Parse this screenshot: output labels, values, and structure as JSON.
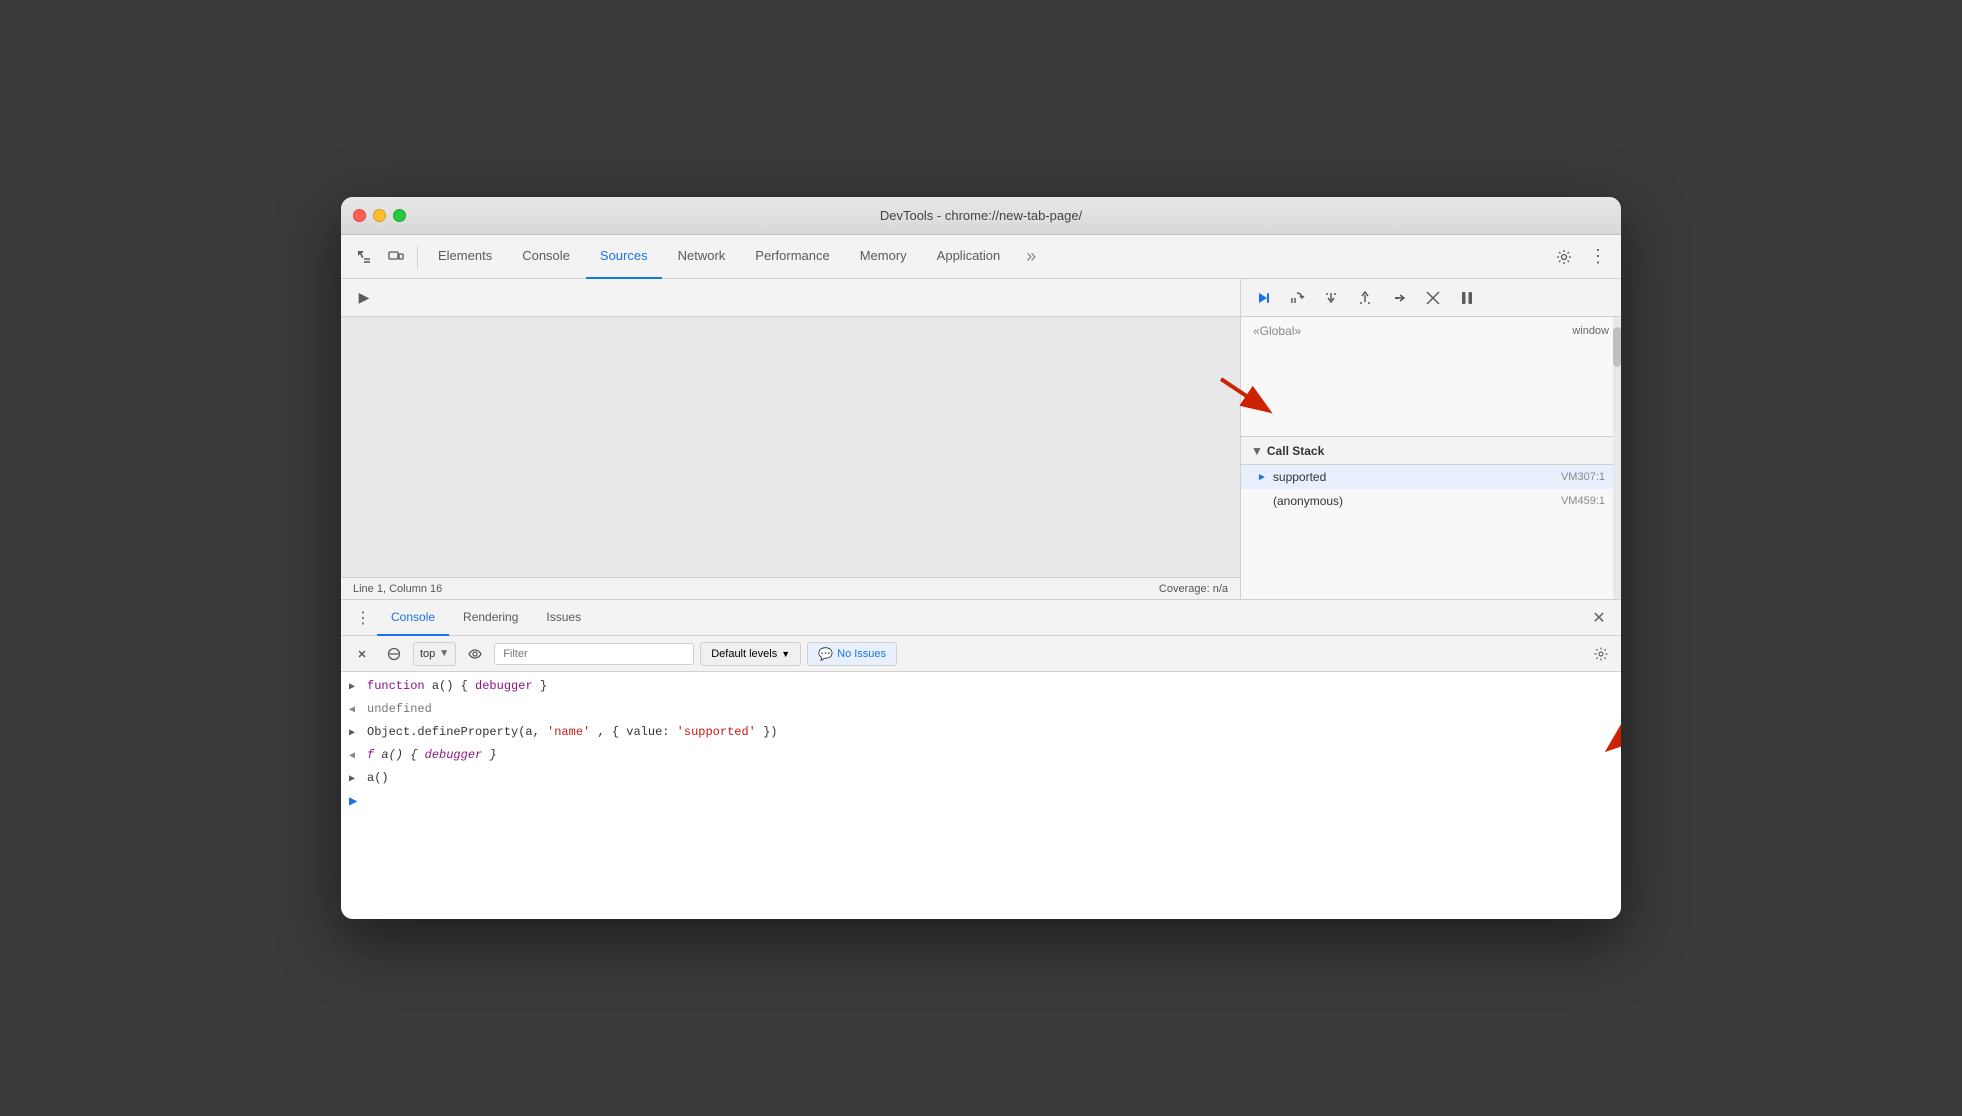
{
  "window": {
    "title": "DevTools - chrome://new-tab-page/"
  },
  "toolbar": {
    "tabs": [
      {
        "id": "elements",
        "label": "Elements",
        "active": false
      },
      {
        "id": "console",
        "label": "Console",
        "active": false
      },
      {
        "id": "sources",
        "label": "Sources",
        "active": true
      },
      {
        "id": "network",
        "label": "Network",
        "active": false
      },
      {
        "id": "performance",
        "label": "Performance",
        "active": false
      },
      {
        "id": "memory",
        "label": "Memory",
        "active": false
      },
      {
        "id": "application",
        "label": "Application",
        "active": false
      }
    ]
  },
  "status_bar": {
    "position": "Line 1, Column 16",
    "coverage": "Coverage: n/a"
  },
  "call_stack": {
    "header": "Call Stack",
    "items": [
      {
        "name": "supported",
        "location": "VM307:1",
        "active": true
      },
      {
        "name": "(anonymous)",
        "location": "VM459:1",
        "active": false
      }
    ],
    "scope_items": [
      {
        "name": "«Global»",
        "val": "window"
      }
    ]
  },
  "console_panel": {
    "tabs": [
      {
        "id": "console",
        "label": "Console",
        "active": true
      },
      {
        "id": "rendering",
        "label": "Rendering",
        "active": false
      },
      {
        "id": "issues",
        "label": "Issues",
        "active": false
      }
    ],
    "toolbar": {
      "context": "top",
      "filter_placeholder": "Filter",
      "levels": "Default levels",
      "no_issues": "No Issues"
    },
    "lines": [
      {
        "type": "input",
        "prefix": ">",
        "content": "function a() { debugger }"
      },
      {
        "type": "return",
        "prefix": "<",
        "content": "undefined"
      },
      {
        "type": "input",
        "prefix": ">",
        "content": "Object.defineProperty(a, 'name', { value: 'supported' })"
      },
      {
        "type": "return",
        "prefix": "<",
        "content": "f a() { debugger }"
      },
      {
        "type": "input",
        "prefix": ">",
        "content": "a()"
      }
    ],
    "prompt": ">"
  }
}
